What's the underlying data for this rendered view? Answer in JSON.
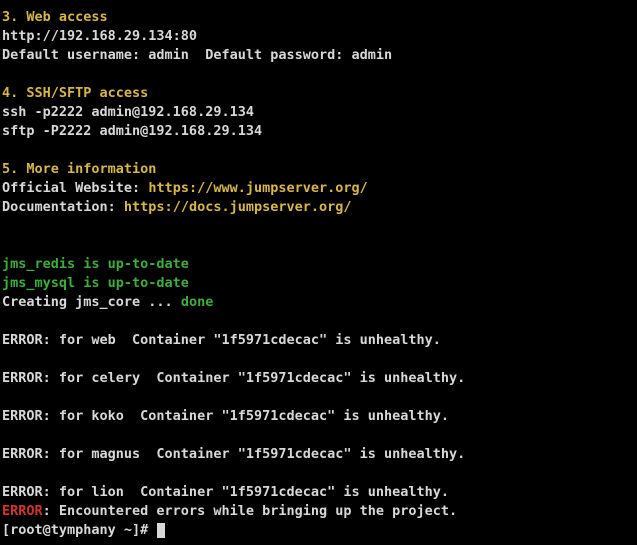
{
  "section_web_header": "3. Web access",
  "web_url": "http://192.168.29.134:80",
  "web_creds": "Default username: admin  Default password: admin",
  "section_ssh_header": "4. SSH/SFTP access",
  "ssh_cmd": "ssh -p2222 admin@192.168.29.134",
  "sftp_cmd": "sftp -P2222 admin@192.168.29.134",
  "section_info_header": "5. More information",
  "info_site_label": "Official Website: ",
  "info_site_url": "https://www.jumpserver.org/",
  "info_docs_label": "Documentation: ",
  "info_docs_url": "https://docs.jumpserver.org/",
  "compose_redis": "jms_redis is up-to-date",
  "compose_mysql": "jms_mysql is up-to-date",
  "compose_core_creating": "Creating jms_core ... ",
  "compose_core_done": "done",
  "err_web": "ERROR: for web  Container \"1f5971cdecac\" is unhealthy.",
  "err_celery": "ERROR: for celery  Container \"1f5971cdecac\" is unhealthy.",
  "err_koko": "ERROR: for koko  Container \"1f5971cdecac\" is unhealthy.",
  "err_magnus": "ERROR: for magnus  Container \"1f5971cdecac\" is unhealthy.",
  "err_lion": "ERROR: for lion  Container \"1f5971cdecac\" is unhealthy.",
  "final_err_tag": "ERROR",
  "final_err_msg": ": Encountered errors while bringing up the project.",
  "prompt": "[root@tymphany ~]# "
}
